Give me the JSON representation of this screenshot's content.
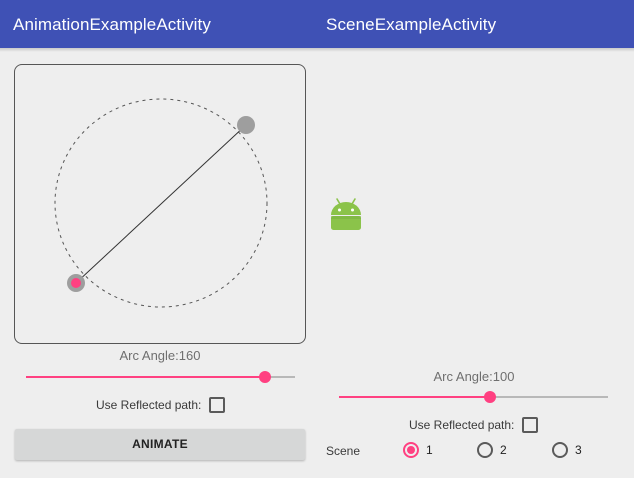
{
  "left_toolbar": {
    "title": "AnimationExampleActivity"
  },
  "right_toolbar": {
    "title": "SceneExampleActivity"
  },
  "left": {
    "arc_angle_text": "Arc Angle:160",
    "arc_angle_slider": {
      "value_fraction": 0.89
    },
    "reflected_label": "Use Reflected path:",
    "reflected_checked": false,
    "animate_label": "ANIMATE"
  },
  "right": {
    "arc_angle_text": "Arc Angle:100",
    "arc_angle_slider": {
      "value_fraction": 0.56
    },
    "reflected_label": "Use Reflected path:",
    "reflected_checked": false,
    "scene_label": "Scene",
    "scene_options": [
      "1",
      "2",
      "3"
    ],
    "scene_selected": "1"
  },
  "colors": {
    "toolbar": "#3f51b5",
    "accent": "#ff4081",
    "android_green": "#8bc34a"
  }
}
